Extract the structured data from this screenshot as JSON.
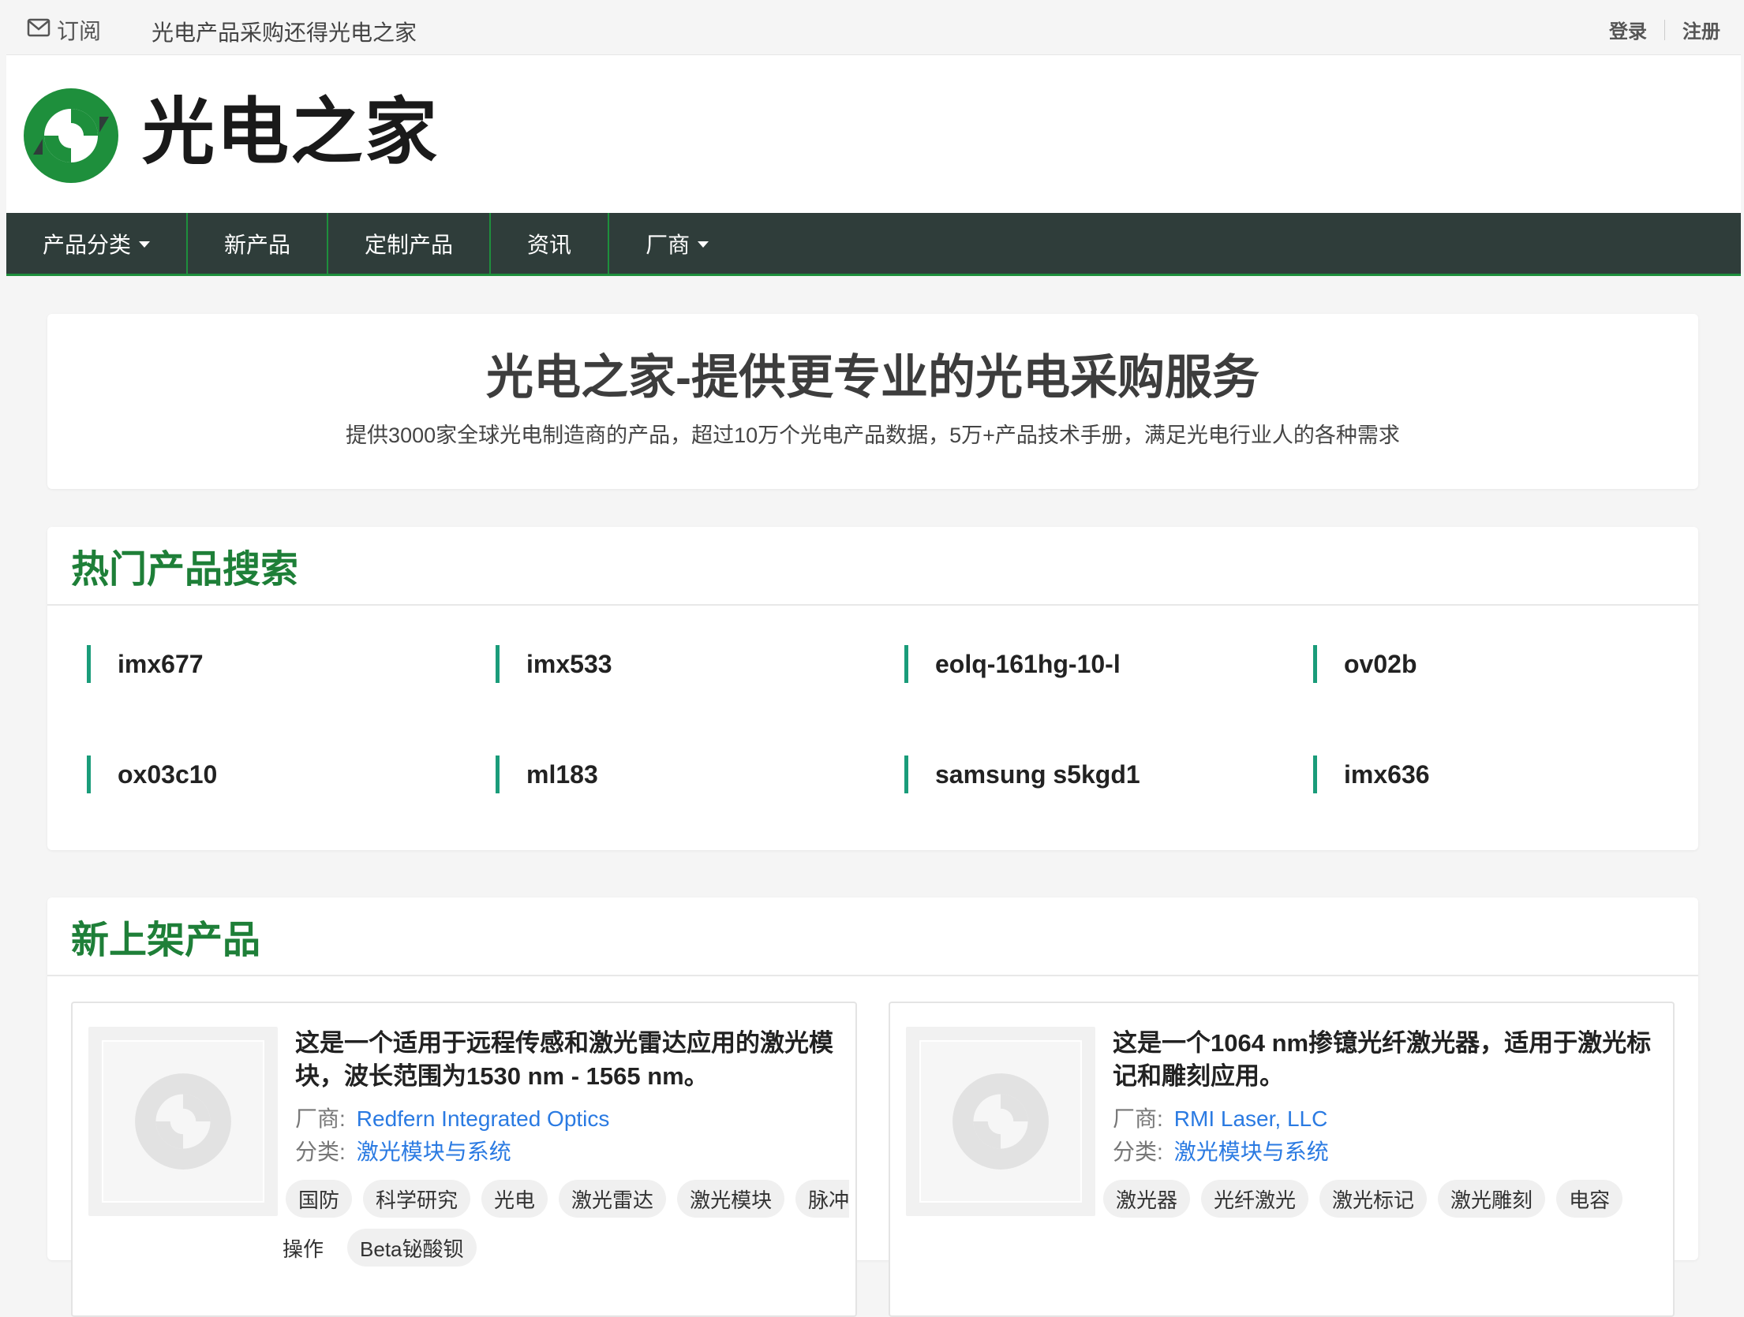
{
  "topbar": {
    "subscribe_label": "订阅",
    "slogan": "光电产品采购还得光电之家",
    "login": "登录",
    "register": "注册"
  },
  "header": {
    "logo_text": "光电之家"
  },
  "nav": {
    "items": [
      {
        "label": "产品分类",
        "dropdown": true
      },
      {
        "label": "新产品",
        "dropdown": false
      },
      {
        "label": "定制产品",
        "dropdown": false
      },
      {
        "label": "资讯",
        "dropdown": false
      },
      {
        "label": "厂商",
        "dropdown": true
      }
    ]
  },
  "hero": {
    "title": "光电之家-提供更专业的光电采购服务",
    "subtitle": "提供3000家全球光电制造商的产品，超过10万个光电产品数据，5万+产品技术手册，满足光电行业人的各种需求"
  },
  "hot_search": {
    "title": "热门产品搜索",
    "items": [
      "imx677",
      "imx533",
      "eolq-161hg-10-l",
      "ov02b",
      "ox03c10",
      "ml183",
      "samsung s5kgd1",
      "imx636"
    ]
  },
  "new_products": {
    "title": "新上架产品",
    "vendor_key": "厂商:",
    "category_key": "分类:",
    "cards": [
      {
        "title": "这是一个适用于远程传感和激光雷达应用的激光模块，波长范围为1530 nm - 1565 nm。",
        "vendor": "Redfern Integrated Optics",
        "category": "激光模块与系统",
        "tags": [
          "国防",
          "科学研究",
          "光电",
          "激光雷达",
          "激光模块",
          "脉冲"
        ],
        "tags_row2": [
          "操作",
          "Beta铋酸钡"
        ]
      },
      {
        "title": "这是一个1064 nm掺镱光纤激光器，适用于激光标记和雕刻应用。",
        "vendor": "RMI Laser, LLC",
        "category": "激光模块与系统",
        "tags": [
          "激光器",
          "光纤激光",
          "激光标记",
          "激光雕刻",
          "电容"
        ],
        "tags_row2": []
      }
    ]
  },
  "colors": {
    "nav_bg": "#2f3d3a",
    "accent_green": "#1e7f38",
    "link_blue": "#2a7ae2",
    "hot_bar": "#1a9c7a"
  }
}
